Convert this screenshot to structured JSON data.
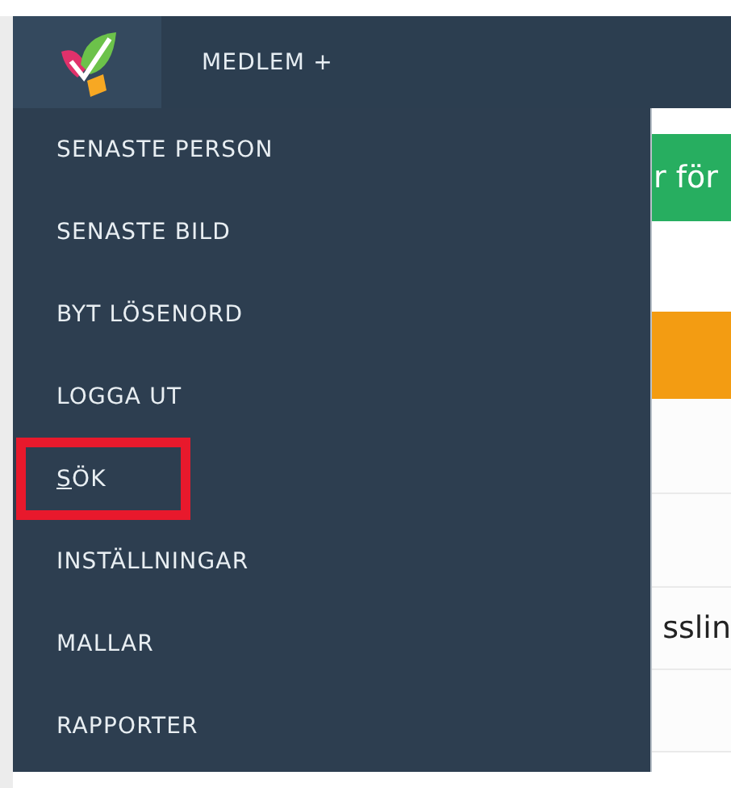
{
  "navbar": {
    "menu_label": "MEDLEM +"
  },
  "dropdown": {
    "items": [
      {
        "label": "SENASTE PERSON",
        "highlighted": false,
        "underline_first": false
      },
      {
        "label": "SENASTE BILD",
        "highlighted": false,
        "underline_first": false
      },
      {
        "label": "BYT LÖSENORD",
        "highlighted": false,
        "underline_first": false
      },
      {
        "label": "LOGGA UT",
        "highlighted": false,
        "underline_first": false
      },
      {
        "label": "SÖK",
        "highlighted": true,
        "underline_first": true
      },
      {
        "label": "INSTÄLLNINGAR",
        "highlighted": false,
        "underline_first": false
      },
      {
        "label": "MALLAR",
        "highlighted": false,
        "underline_first": false
      },
      {
        "label": "RAPPORTER",
        "highlighted": false,
        "underline_first": false
      }
    ]
  },
  "background": {
    "banner_text": "r för",
    "row_text": "sslin"
  }
}
